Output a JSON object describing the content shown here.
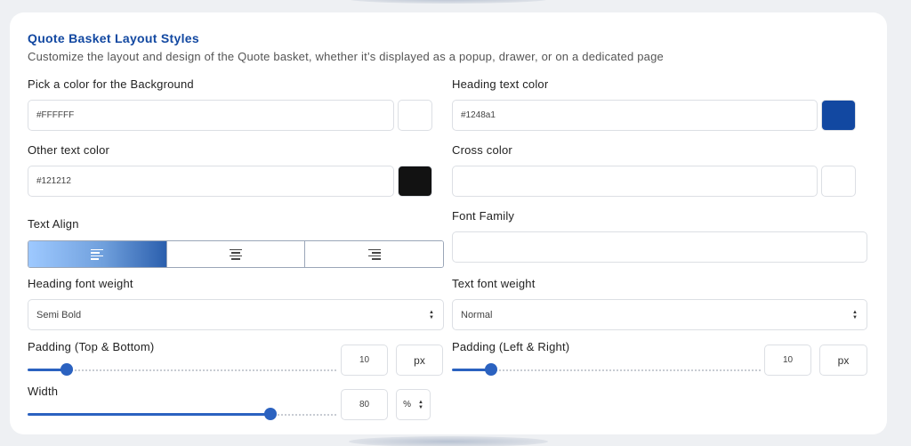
{
  "header": {
    "title": "Quote Basket Layout Styles",
    "subtitle": "Customize the layout and design of the Quote basket, whether it’s displayed as a popup, drawer, or on a dedicated page"
  },
  "background_color": {
    "label": "Pick a color for the Background",
    "value": "#FFFFFF",
    "swatch": "#ffffff"
  },
  "heading_text_color": {
    "label": "Heading text color",
    "value": "#1248a1",
    "swatch": "#1248a1"
  },
  "other_text_color": {
    "label": "Other text color",
    "value": "#121212",
    "swatch": "#121212"
  },
  "cross_color": {
    "label": "Cross color",
    "value": "",
    "swatch": "#ffffff"
  },
  "text_align": {
    "label": "Text Align",
    "options": [
      "left-align-icon",
      "center-align-icon",
      "right-align-icon"
    ],
    "selected": "left"
  },
  "font_family": {
    "label": "Font Family",
    "value": ""
  },
  "heading_font_weight": {
    "label": "Heading font weight",
    "value": "Semi Bold"
  },
  "text_font_weight": {
    "label": "Text font weight",
    "value": "Normal"
  },
  "padding_tb": {
    "label": "Padding (Top & Bottom)",
    "value": "10",
    "unit": "px",
    "slider_fraction": 0.11
  },
  "padding_lr": {
    "label": "Padding (Left & Right)",
    "value": "10",
    "unit": "px",
    "slider_fraction": 0.11
  },
  "width": {
    "label": "Width",
    "value": "80",
    "unit": "%",
    "slider_fraction": 0.8
  }
}
